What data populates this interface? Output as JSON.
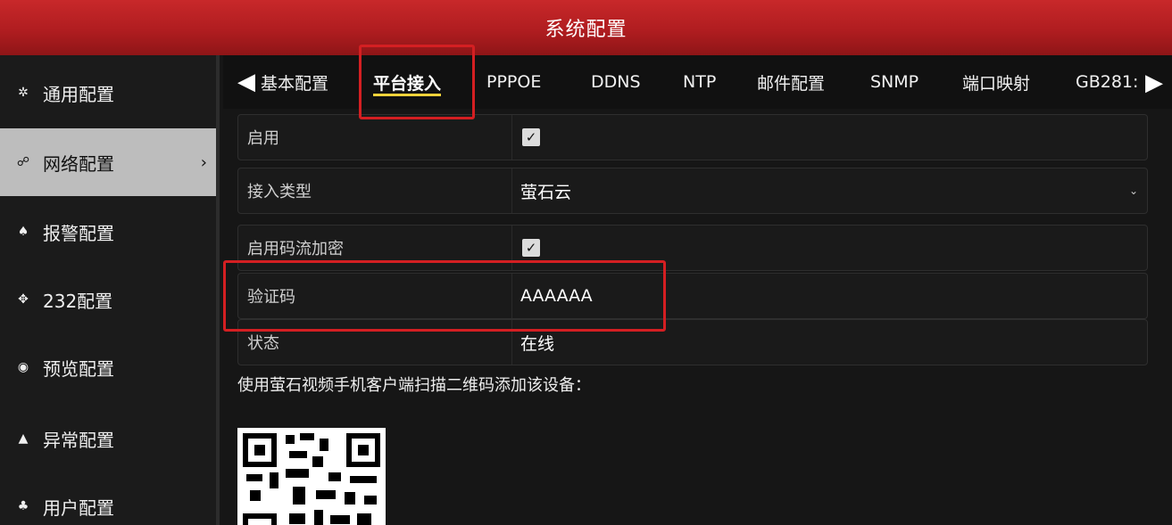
{
  "window": {
    "title": "系统配置"
  },
  "sidebar": {
    "items": [
      {
        "label": "通用配置",
        "icon": "gear-icon",
        "glyph": "✲"
      },
      {
        "label": "网络配置",
        "icon": "network-icon",
        "glyph": "☍",
        "arrow": "›"
      },
      {
        "label": "报警配置",
        "icon": "alarm-icon",
        "glyph": "♠"
      },
      {
        "label": "232配置",
        "icon": "serial-icon",
        "glyph": "✥"
      },
      {
        "label": "预览配置",
        "icon": "eye-icon",
        "glyph": "◉"
      },
      {
        "label": "异常配置",
        "icon": "warning-icon",
        "glyph": "▲"
      },
      {
        "label": "用户配置",
        "icon": "users-icon",
        "glyph": "♣"
      }
    ]
  },
  "tabs": {
    "prev_arrow": "◀",
    "next_arrow": "▶",
    "items": [
      "基本配置",
      "平台接入",
      "PPPOE",
      "DDNS",
      "NTP",
      "邮件配置",
      "SNMP",
      "端口映射",
      "GB281:"
    ],
    "active": "平台接入"
  },
  "form": {
    "enable": {
      "label": "启用",
      "checked": true,
      "check_glyph": "✓"
    },
    "access_type": {
      "label": "接入类型",
      "value": "萤石云",
      "caret": "⌄"
    },
    "stream_encrypt": {
      "label": "启用码流加密",
      "checked": true,
      "check_glyph": "✓"
    },
    "verify_code": {
      "label": "验证码",
      "value": "AAAAAA"
    },
    "status": {
      "label": "状态",
      "value": "在线"
    }
  },
  "hint": "使用萤石视频手机客户端扫描二维码添加该设备：",
  "colors": {
    "title_red": "#b01d20",
    "highlight_red": "#d41f22",
    "tab_underline": "#f0d23a"
  }
}
